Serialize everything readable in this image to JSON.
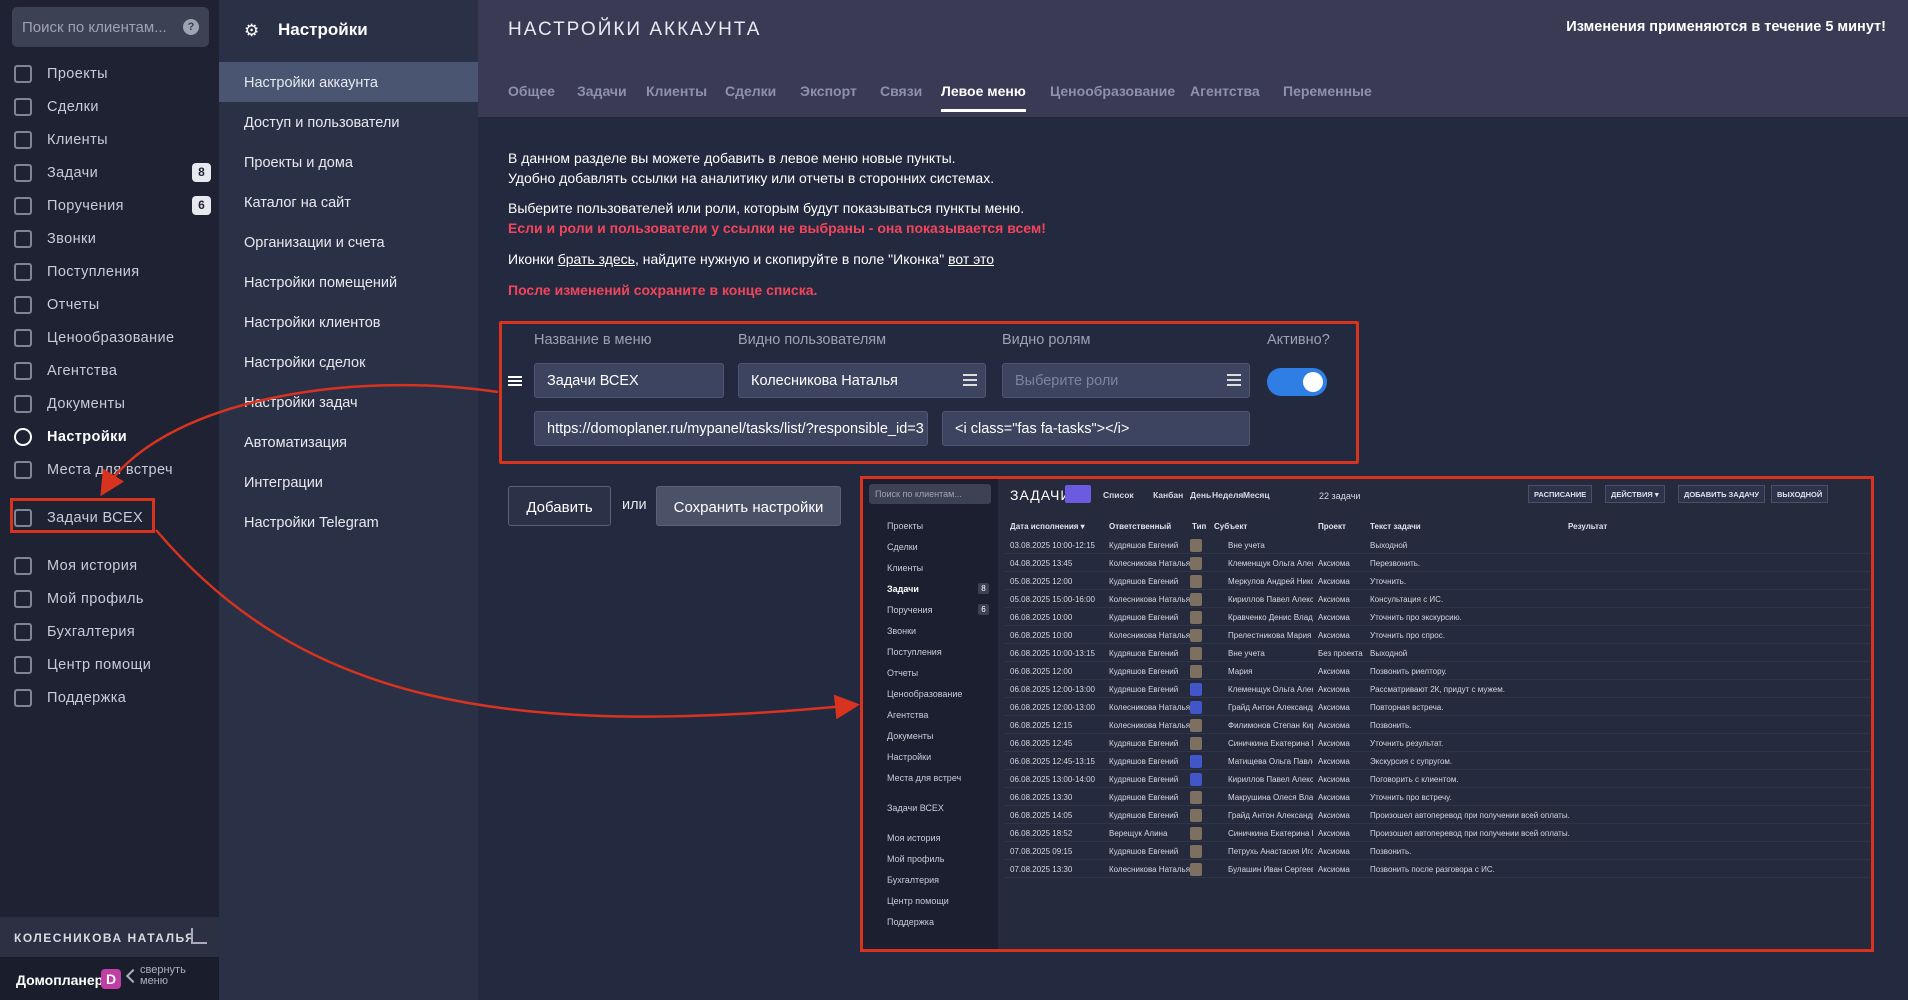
{
  "sidebar": {
    "search_placeholder": "Поиск по клиентам...",
    "items": [
      {
        "label": "Проекты"
      },
      {
        "label": "Сделки"
      },
      {
        "label": "Клиенты"
      },
      {
        "label": "Задачи",
        "badge": "8"
      },
      {
        "label": "Поручения",
        "badge": "6"
      },
      {
        "label": "Звонки"
      },
      {
        "label": "Поступления"
      },
      {
        "label": "Отчеты"
      },
      {
        "label": "Ценообразование"
      },
      {
        "label": "Агентства"
      },
      {
        "label": "Документы"
      },
      {
        "label": "Настройки"
      },
      {
        "label": "Места для встреч"
      },
      {
        "label": "Задачи ВСЕХ"
      },
      {
        "label": "Моя история"
      },
      {
        "label": "Мой профиль"
      },
      {
        "label": "Бухгалтерия"
      },
      {
        "label": "Центр помощи"
      },
      {
        "label": "Поддержка"
      }
    ],
    "user": "КОЛЕСНИКОВА НАТАЛЬЯ",
    "brand": "Домопланер",
    "collapse": "свернуть меню"
  },
  "settings": {
    "title": "Настройки",
    "items": [
      "Настройки аккаунта",
      "Доступ и пользователи",
      "Проекты и дома",
      "Каталог на сайт",
      "Организации и счета",
      "Настройки помещений",
      "Настройки клиентов",
      "Настройки сделок",
      "Настройки задач",
      "Автоматизация",
      "Интеграции",
      "Настройки Telegram"
    ]
  },
  "header": {
    "title": "НАСТРОЙКИ АККАУНТА",
    "notice": "Изменения применяются в течение 5 минут!"
  },
  "tabs": [
    "Общее",
    "Задачи",
    "Клиенты",
    "Сделки",
    "Экспорт",
    "Связи",
    "Левое меню",
    "Ценообразование",
    "Агентства",
    "Переменные"
  ],
  "text": {
    "l1": "В данном разделе вы можете добавить в левое меню новые пункты.",
    "l2": "Удобно добавлять ссылки на аналитику или отчеты в сторонних системах.",
    "l3": "Выберите пользователей или роли, которым будут показываться пункты меню.",
    "l4": "Если и роли и пользователи у ссылки не выбраны - она показывается всем!",
    "l5a": "Иконки ",
    "l5b": "брать здесь",
    "l5c": ", найдите нужную и скопируйте в поле \"Иконка\" ",
    "l5d": "вот это",
    "l6": "После изменений сохраните в конце списка."
  },
  "form": {
    "h_name": "Название в меню",
    "h_users": "Видно пользователям",
    "h_roles": "Видно ролям",
    "h_active": "Активно?",
    "name": "Задачи ВСЕХ",
    "users": "Колесникова Наталья",
    "roles_placeholder": "Выберите роли",
    "url": "https://domoplaner.ru/mypanel/tasks/list/?responsible_id=3",
    "icon": "<i class=\"fas fa-tasks\"></i>"
  },
  "buttons": {
    "add": "Добавить",
    "or": "или",
    "save": "Сохранить настройки"
  },
  "shot": {
    "search": "Поиск по клиентам...",
    "title": "ЗАДАЧИ",
    "views": [
      "Список",
      "Канбан",
      "День",
      "Неделя",
      "Месяц"
    ],
    "count": "22 задачи",
    "btns": [
      "РАСПИСАНИЕ",
      "ДЕЙСТВИЯ ▾",
      "ДОБАВИТЬ ЗАДАЧУ",
      "ВЫХОДНОЙ"
    ],
    "cols": [
      "Дата исполнения ▾",
      "Ответственный",
      "Тип",
      "Субъект",
      "Проект",
      "Текст задачи",
      "Результат"
    ],
    "rows": [
      [
        "03.08.2025 10:00-12:15",
        "Кудряшов Евгений",
        "Вне учета",
        "",
        "Выходной"
      ],
      [
        "04.08.2025 13:45",
        "Колесникова Наталья",
        "Клеменщук Ольга Алексан",
        "Аксиома",
        "Перезвонить."
      ],
      [
        "05.08.2025 12:00",
        "Кудряшов Евгений",
        "Меркулов Андрей Никола",
        "Аксиома",
        "Уточнить."
      ],
      [
        "05.08.2025 15:00-16:00",
        "Колесникова Наталья",
        "Кириллов Павел Александ",
        "Аксиома",
        "Консультация с ИС."
      ],
      [
        "06.08.2025 10:00",
        "Кудряшов Евгений",
        "Кравченко Денис Владими",
        "Аксиома",
        "Уточнить про экскурсию."
      ],
      [
        "06.08.2025 10:00",
        "Колесникова Наталья",
        "Прелестникова Мария Але",
        "Аксиома",
        "Уточнить про спрос."
      ],
      [
        "06.08.2025 10:00-13:15",
        "Кудряшов Евгений",
        "Вне учета",
        "Без проекта",
        "Выходной"
      ],
      [
        "06.08.2025 12:00",
        "Кудряшов Евгений",
        "Мария",
        "Аксиома",
        "Позвонить риелтору."
      ],
      [
        "06.08.2025 12:00-13:00",
        "Кудряшов Евгений",
        "Клеменщук Ольга Алексан",
        "Аксиома",
        "Рассматривают 2К, придут с мужем."
      ],
      [
        "06.08.2025 12:00-13:00",
        "Колесникова Наталья",
        "Грайд Антон Александров",
        "Аксиома",
        "Повторная встреча."
      ],
      [
        "06.08.2025 12:15",
        "Колесникова Наталья",
        "Филимонов Степан Кирил",
        "Аксиома",
        "Позвонить."
      ],
      [
        "06.08.2025 12:45",
        "Кудряшов Евгений",
        "Синичкина Екатерина Вла",
        "Аксиома",
        "Уточнить результат."
      ],
      [
        "06.08.2025 12:45-13:15",
        "Кудряшов Евгений",
        "Матищева Ольга Павловн",
        "Аксиома",
        "Экскурсия с супругом."
      ],
      [
        "06.08.2025 13:00-14:00",
        "Кудряшов Евгений",
        "Кириллов Павел Александ",
        "Аксиома",
        "Поговорить с клиентом."
      ],
      [
        "06.08.2025 13:30",
        "Кудряшов Евгений",
        "Макрушина Олеся Владим",
        "Аксиома",
        "Уточнить про встречу."
      ],
      [
        "06.08.2025 14:05",
        "Кудряшов Евгений",
        "Грайд Антон Александров",
        "Аксиома",
        "Произошел автоперевод при получении всей оплаты. Зап"
      ],
      [
        "06.08.2025 18:52",
        "Верещук Алина",
        "Синичкина Екатерина Вла",
        "Аксиома",
        "Произошел автоперевод при получении всей оплаты. Зап"
      ],
      [
        "07.08.2025 09:15",
        "Кудряшов Евгений",
        "Петрухь Анастасия Игоре",
        "Аксиома",
        "Позвонить."
      ],
      [
        "07.08.2025 13:30",
        "Колесникова Наталья",
        "Булашин Иван Сергееви",
        "Аксиома",
        "Позвонить после разговора с ИС."
      ]
    ]
  },
  "colors": {
    "annotation": "#d8331e",
    "toggle": "#2f7ee6",
    "brand": "#c13fa4",
    "warning": "#f2455b"
  }
}
